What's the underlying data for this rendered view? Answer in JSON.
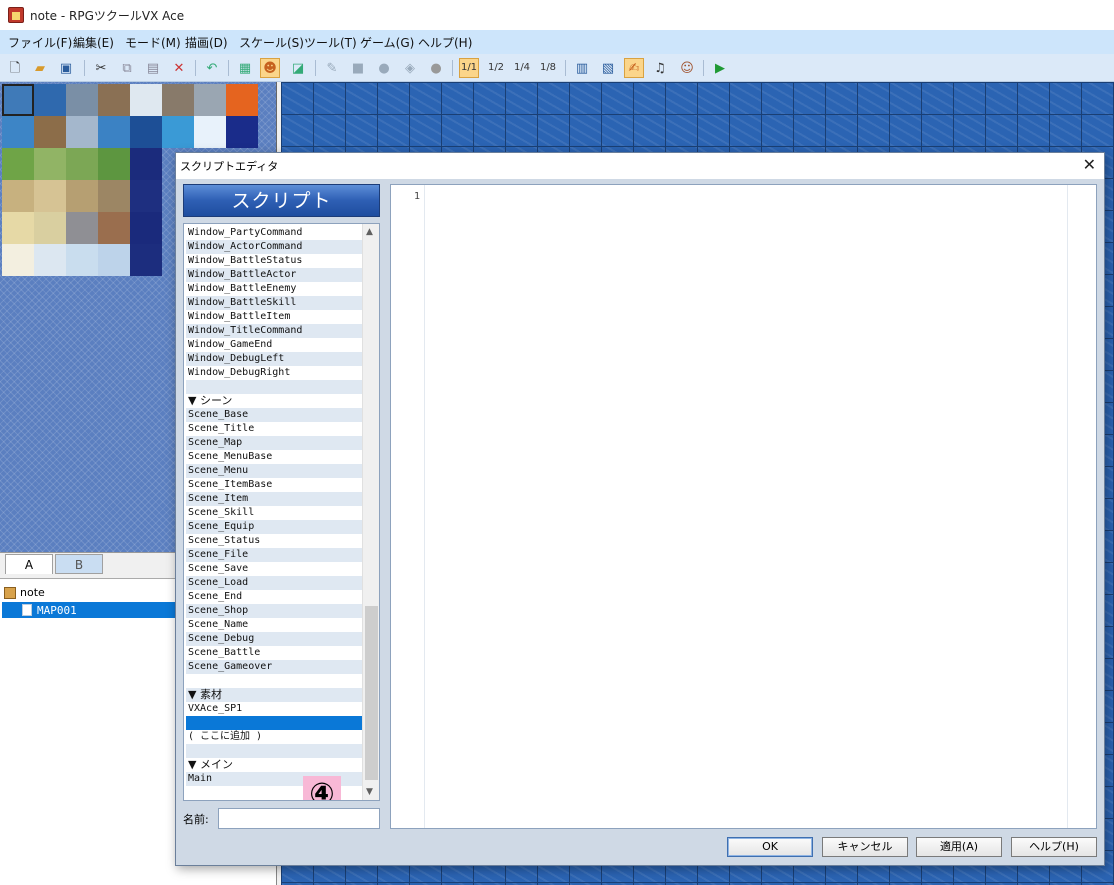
{
  "window": {
    "title": "note - RPGツクールVX Ace"
  },
  "menu": [
    "ファイル(F)",
    "編集(E)",
    "モード(M)",
    "描画(D)",
    "スケール(S)",
    "ツール(T)",
    "ゲーム(G)",
    "ヘルプ(H)"
  ],
  "toolbar": {
    "scale_labels": [
      "1/1",
      "1/2",
      "1/4",
      "1/8"
    ],
    "icons": [
      "new-project-icon",
      "open-project-icon",
      "save-project-icon",
      "cut-icon",
      "copy-icon",
      "paste-icon",
      "delete-icon",
      "undo-icon",
      "map-layer-icon",
      "event-layer-icon",
      "region-icon",
      "pencil-icon",
      "rectangle-icon",
      "ellipse-icon",
      "flood-fill-icon",
      "shadow-pen-icon",
      "database-icon",
      "resource-manager-icon",
      "script-editor-icon",
      "sound-test-icon",
      "character-generator-icon",
      "playtest-icon"
    ]
  },
  "tileset": {
    "tabs": [
      "A",
      "B"
    ]
  },
  "maptree": {
    "root": "note",
    "items": [
      "MAP001"
    ]
  },
  "dialog": {
    "title": "スクリプトエディタ",
    "header": "スクリプト",
    "scripts": [
      "Window_PartyCommand",
      "Window_ActorCommand",
      "Window_BattleStatus",
      "Window_BattleActor",
      "Window_BattleEnemy",
      "Window_BattleSkill",
      "Window_BattleItem",
      "Window_TitleCommand",
      "Window_GameEnd",
      "Window_DebugLeft",
      "Window_DebugRight",
      "",
      "▼ シーン",
      "Scene_Base",
      "Scene_Title",
      "Scene_Map",
      "Scene_MenuBase",
      "Scene_Menu",
      "Scene_ItemBase",
      "Scene_Item",
      "Scene_Skill",
      "Scene_Equip",
      "Scene_Status",
      "Scene_File",
      "Scene_Save",
      "Scene_Load",
      "Scene_End",
      "Scene_Shop",
      "Scene_Name",
      "Scene_Debug",
      "Scene_Battle",
      "Scene_Gameover",
      "",
      "▼ 素材",
      "VXAce_SP1",
      "",
      "( ここに追加 )",
      "",
      "▼ メイン",
      "Main",
      ""
    ],
    "selected_index": 35,
    "annotation": "④",
    "name_label": "名前:",
    "name_value": "",
    "editor_line_number": "1",
    "buttons": [
      "OK",
      "キャンセル",
      "適用(A)",
      "ヘルプ(H)"
    ]
  },
  "colors": {
    "accent": "#0a78d7",
    "menu_bg": "#cde5fb",
    "header_blue": "#2e5fb4",
    "annotation_pink": "#f8b8d6"
  }
}
